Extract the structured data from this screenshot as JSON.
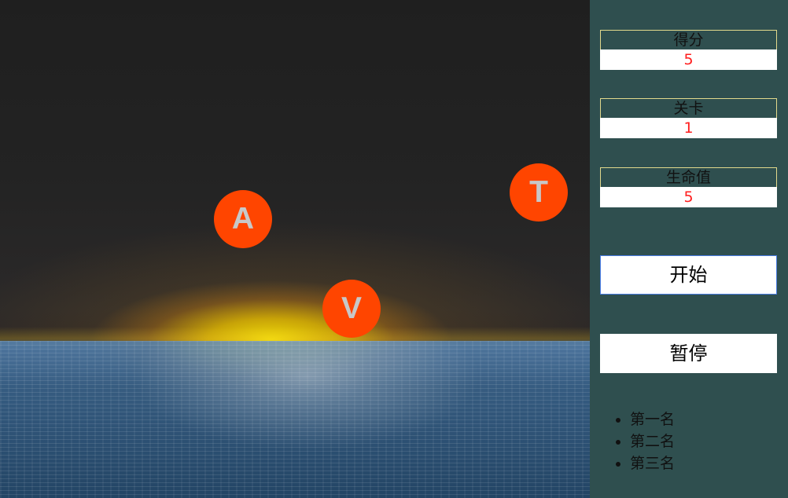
{
  "game": {
    "falling_letters": [
      {
        "text": "A",
        "color": "#ff4500"
      },
      {
        "text": "V",
        "color": "#ff4500"
      },
      {
        "text": "T",
        "color": "#ff4500"
      }
    ]
  },
  "sidebar": {
    "score": {
      "label": "得分",
      "value": "5"
    },
    "level": {
      "label": "关卡",
      "value": "1"
    },
    "life": {
      "label": "生命值",
      "value": "5"
    },
    "buttons": {
      "start": "开始",
      "pause": "暂停"
    },
    "ranking": [
      "第一名",
      "第二名",
      "第三名"
    ]
  },
  "colors": {
    "sidebar_background": "#2f4f4f",
    "letter_ball": "#ff4500",
    "stat_value": "#ff1d1d",
    "stat_border": "#e2d98c",
    "start_button_border": "#4a7de4"
  }
}
